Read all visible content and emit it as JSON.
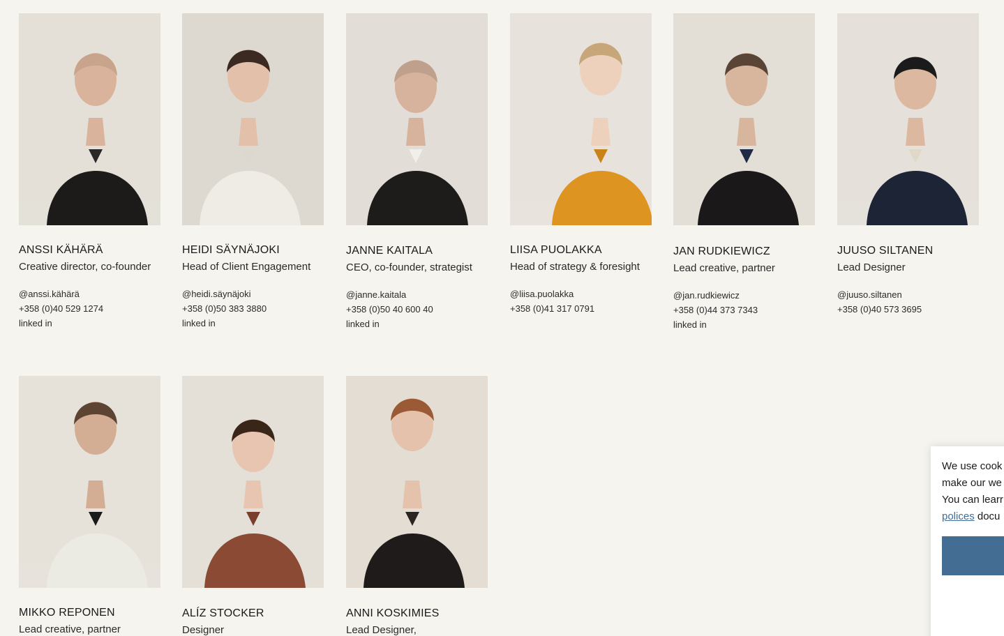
{
  "people": [
    {
      "name": "ANSSI KÄHÄRÄ",
      "role": "Creative director, co-founder",
      "handle": "@anssi.kähärä",
      "phone": "+358 (0)40 529 1274",
      "linkedin": "linked in"
    },
    {
      "name": "HEIDI SÄYNÄJOKI",
      "role": "Head of Client Engagement",
      "handle": "@heidi.säynäjoki",
      "phone": "+358 (0)50 383 3880",
      "linkedin": "linked in"
    },
    {
      "name": "JANNE KAITALA",
      "role": "CEO, co-founder, strategist",
      "handle": "@janne.kaitala",
      "phone": "+358 (0)50 40 600 40",
      "linkedin": "linked in"
    },
    {
      "name": "LIISA PUOLAKKA",
      "role": "Head of strategy & foresight",
      "handle": "@liisa.puolakka",
      "phone": "+358 (0)41 317 0791",
      "linkedin": ""
    },
    {
      "name": "JAN RUDKIEWICZ",
      "role": "Lead creative, partner",
      "handle": "@jan.rudkiewicz",
      "phone": "+358 (0)44 373 7343",
      "linkedin": "linked in"
    },
    {
      "name": "JUUSO SILTANEN",
      "role": "Lead Designer",
      "handle": "@juuso.siltanen",
      "phone": "+358 (0)40 573 3695",
      "linkedin": ""
    },
    {
      "name": "MIKKO REPONEN",
      "role": "Lead creative, partner",
      "handle": "",
      "phone": "",
      "linkedin": ""
    },
    {
      "name": "ALÍZ STOCKER",
      "role": "Designer",
      "handle": "",
      "phone": "",
      "linkedin": ""
    },
    {
      "name": "ANNI KOSKIMIES",
      "role": "Lead Designer,",
      "handle": "",
      "phone": "",
      "linkedin": ""
    }
  ],
  "cookie": {
    "line1": "We use cook",
    "line2": "make our we",
    "line3": "You can learr",
    "link": "polices",
    "line4_rest": " docu"
  },
  "colors": {
    "background": "#f5f4ee",
    "accent": "#446d94",
    "link": "#3f6d96"
  }
}
